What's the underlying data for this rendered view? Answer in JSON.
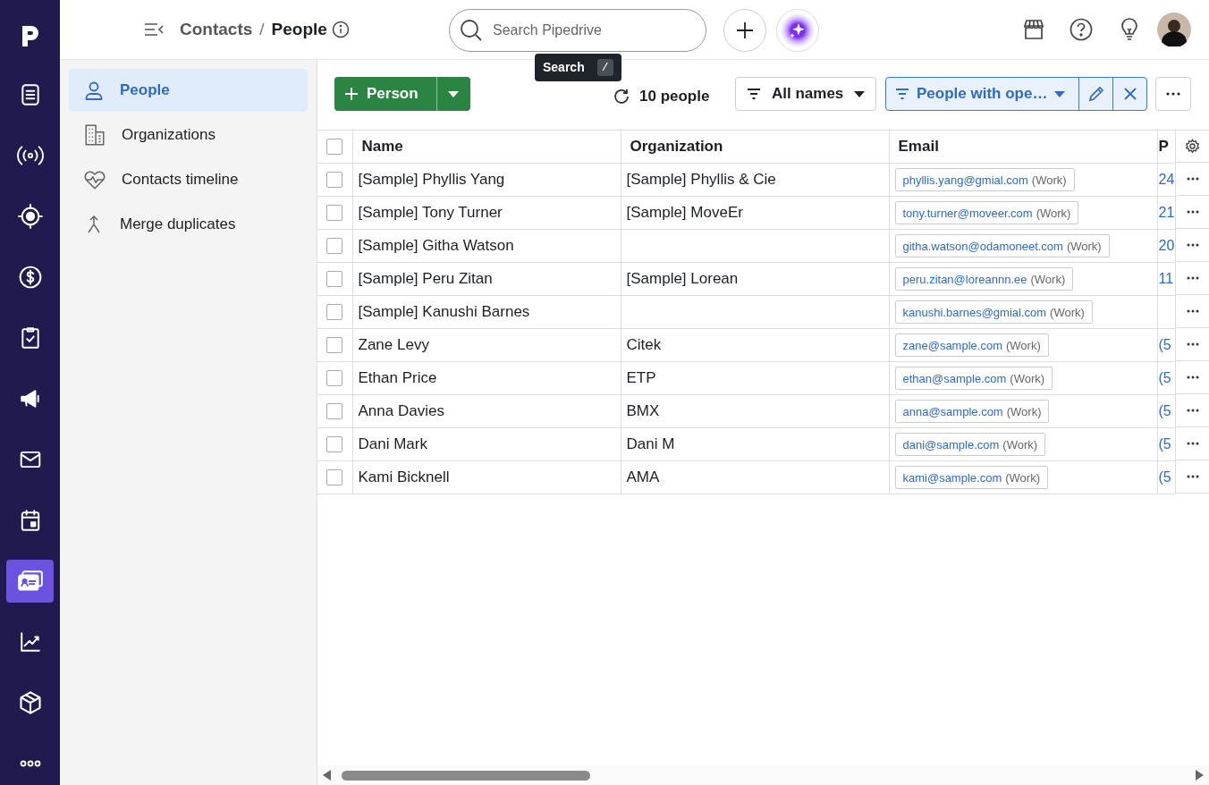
{
  "rail": [
    {
      "selected": false
    },
    {
      "selected": false
    },
    {
      "selected": false
    },
    {
      "selected": false
    },
    {
      "selected": false
    },
    {
      "selected": false
    },
    {
      "selected": false
    },
    {
      "selected": false
    },
    {
      "selected": false
    },
    {
      "selected": true
    },
    {
      "selected": false
    },
    {
      "selected": false
    },
    {
      "selected": false
    }
  ],
  "breadcrumb": {
    "parent": "Contacts",
    "separator": "/",
    "current": "People"
  },
  "search": {
    "placeholder": "Search Pipedrive",
    "tooltip": "Search",
    "shortcut": "/"
  },
  "sidebar": {
    "items": [
      {
        "label": "People",
        "selected": true
      },
      {
        "label": "Organizations",
        "selected": false
      },
      {
        "label": "Contacts timeline",
        "selected": false
      },
      {
        "label": "Merge duplicates",
        "selected": false
      }
    ]
  },
  "toolbar": {
    "add_button": "Person",
    "count": "10 people",
    "owner_filter": "All names",
    "active_filter": "People with ope…"
  },
  "table": {
    "all_selected": false,
    "columns": [
      "Name",
      "Organization",
      "Email",
      "P"
    ],
    "rows": [
      {
        "checked": false,
        "name": "[Sample] Phyllis Yang",
        "organization": "[Sample] Phyllis & Cie",
        "email": "phyllis.yang@gmial.com",
        "email_type": "(Work)",
        "phone": "24"
      },
      {
        "checked": false,
        "name": "[Sample] Tony Turner",
        "organization": "[Sample] MoveEr",
        "email": "tony.turner@moveer.com",
        "email_type": "(Work)",
        "phone": "21"
      },
      {
        "checked": false,
        "name": "[Sample] Githa Watson",
        "email": "githa.watson@odamoneet.com",
        "email_type": "(Work)",
        "phone": "20"
      },
      {
        "checked": false,
        "name": "[Sample] Peru Zitan",
        "organization": "[Sample] Lorean",
        "email": "peru.zitan@loreannn.ee",
        "email_type": "(Work)",
        "phone": "11"
      },
      {
        "checked": false,
        "name": "[Sample] Kanushi Barnes",
        "email": "kanushi.barnes@gmial.com",
        "email_type": "(Work)"
      },
      {
        "checked": false,
        "name": "Zane Levy",
        "organization": "Citek",
        "email": "zane@sample.com",
        "email_type": "(Work)",
        "phone": "(5"
      },
      {
        "checked": false,
        "name": "Ethan Price",
        "organization": "ETP",
        "email": "ethan@sample.com",
        "email_type": "(Work)",
        "phone": "(5"
      },
      {
        "checked": false,
        "name": "Anna Davies",
        "organization": "BMX",
        "email": "anna@sample.com",
        "email_type": "(Work)",
        "phone": "(5"
      },
      {
        "checked": false,
        "name": "Dani Mark",
        "organization": "Dani M",
        "email": "dani@sample.com",
        "email_type": "(Work)",
        "phone": "(5"
      },
      {
        "checked": false,
        "name": "Kami Bicknell",
        "organization": "AMA",
        "email": "kami@sample.com",
        "email_type": "(Work)",
        "phone": "(5"
      }
    ]
  }
}
